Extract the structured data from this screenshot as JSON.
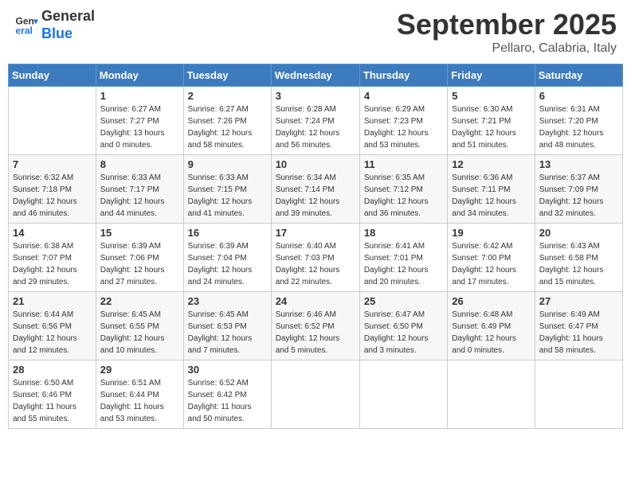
{
  "header": {
    "logo_line1": "General",
    "logo_line2": "Blue",
    "month": "September 2025",
    "location": "Pellaro, Calabria, Italy"
  },
  "days_of_week": [
    "Sunday",
    "Monday",
    "Tuesday",
    "Wednesday",
    "Thursday",
    "Friday",
    "Saturday"
  ],
  "weeks": [
    [
      {
        "day": "",
        "info": ""
      },
      {
        "day": "1",
        "info": "Sunrise: 6:27 AM\nSunset: 7:27 PM\nDaylight: 13 hours\nand 0 minutes."
      },
      {
        "day": "2",
        "info": "Sunrise: 6:27 AM\nSunset: 7:26 PM\nDaylight: 12 hours\nand 58 minutes."
      },
      {
        "day": "3",
        "info": "Sunrise: 6:28 AM\nSunset: 7:24 PM\nDaylight: 12 hours\nand 56 minutes."
      },
      {
        "day": "4",
        "info": "Sunrise: 6:29 AM\nSunset: 7:23 PM\nDaylight: 12 hours\nand 53 minutes."
      },
      {
        "day": "5",
        "info": "Sunrise: 6:30 AM\nSunset: 7:21 PM\nDaylight: 12 hours\nand 51 minutes."
      },
      {
        "day": "6",
        "info": "Sunrise: 6:31 AM\nSunset: 7:20 PM\nDaylight: 12 hours\nand 48 minutes."
      }
    ],
    [
      {
        "day": "7",
        "info": "Sunrise: 6:32 AM\nSunset: 7:18 PM\nDaylight: 12 hours\nand 46 minutes."
      },
      {
        "day": "8",
        "info": "Sunrise: 6:33 AM\nSunset: 7:17 PM\nDaylight: 12 hours\nand 44 minutes."
      },
      {
        "day": "9",
        "info": "Sunrise: 6:33 AM\nSunset: 7:15 PM\nDaylight: 12 hours\nand 41 minutes."
      },
      {
        "day": "10",
        "info": "Sunrise: 6:34 AM\nSunset: 7:14 PM\nDaylight: 12 hours\nand 39 minutes."
      },
      {
        "day": "11",
        "info": "Sunrise: 6:35 AM\nSunset: 7:12 PM\nDaylight: 12 hours\nand 36 minutes."
      },
      {
        "day": "12",
        "info": "Sunrise: 6:36 AM\nSunset: 7:11 PM\nDaylight: 12 hours\nand 34 minutes."
      },
      {
        "day": "13",
        "info": "Sunrise: 6:37 AM\nSunset: 7:09 PM\nDaylight: 12 hours\nand 32 minutes."
      }
    ],
    [
      {
        "day": "14",
        "info": "Sunrise: 6:38 AM\nSunset: 7:07 PM\nDaylight: 12 hours\nand 29 minutes."
      },
      {
        "day": "15",
        "info": "Sunrise: 6:39 AM\nSunset: 7:06 PM\nDaylight: 12 hours\nand 27 minutes."
      },
      {
        "day": "16",
        "info": "Sunrise: 6:39 AM\nSunset: 7:04 PM\nDaylight: 12 hours\nand 24 minutes."
      },
      {
        "day": "17",
        "info": "Sunrise: 6:40 AM\nSunset: 7:03 PM\nDaylight: 12 hours\nand 22 minutes."
      },
      {
        "day": "18",
        "info": "Sunrise: 6:41 AM\nSunset: 7:01 PM\nDaylight: 12 hours\nand 20 minutes."
      },
      {
        "day": "19",
        "info": "Sunrise: 6:42 AM\nSunset: 7:00 PM\nDaylight: 12 hours\nand 17 minutes."
      },
      {
        "day": "20",
        "info": "Sunrise: 6:43 AM\nSunset: 6:58 PM\nDaylight: 12 hours\nand 15 minutes."
      }
    ],
    [
      {
        "day": "21",
        "info": "Sunrise: 6:44 AM\nSunset: 6:56 PM\nDaylight: 12 hours\nand 12 minutes."
      },
      {
        "day": "22",
        "info": "Sunrise: 6:45 AM\nSunset: 6:55 PM\nDaylight: 12 hours\nand 10 minutes."
      },
      {
        "day": "23",
        "info": "Sunrise: 6:45 AM\nSunset: 6:53 PM\nDaylight: 12 hours\nand 7 minutes."
      },
      {
        "day": "24",
        "info": "Sunrise: 6:46 AM\nSunset: 6:52 PM\nDaylight: 12 hours\nand 5 minutes."
      },
      {
        "day": "25",
        "info": "Sunrise: 6:47 AM\nSunset: 6:50 PM\nDaylight: 12 hours\nand 3 minutes."
      },
      {
        "day": "26",
        "info": "Sunrise: 6:48 AM\nSunset: 6:49 PM\nDaylight: 12 hours\nand 0 minutes."
      },
      {
        "day": "27",
        "info": "Sunrise: 6:49 AM\nSunset: 6:47 PM\nDaylight: 11 hours\nand 58 minutes."
      }
    ],
    [
      {
        "day": "28",
        "info": "Sunrise: 6:50 AM\nSunset: 6:46 PM\nDaylight: 11 hours\nand 55 minutes."
      },
      {
        "day": "29",
        "info": "Sunrise: 6:51 AM\nSunset: 6:44 PM\nDaylight: 11 hours\nand 53 minutes."
      },
      {
        "day": "30",
        "info": "Sunrise: 6:52 AM\nSunset: 6:42 PM\nDaylight: 11 hours\nand 50 minutes."
      },
      {
        "day": "",
        "info": ""
      },
      {
        "day": "",
        "info": ""
      },
      {
        "day": "",
        "info": ""
      },
      {
        "day": "",
        "info": ""
      }
    ]
  ]
}
